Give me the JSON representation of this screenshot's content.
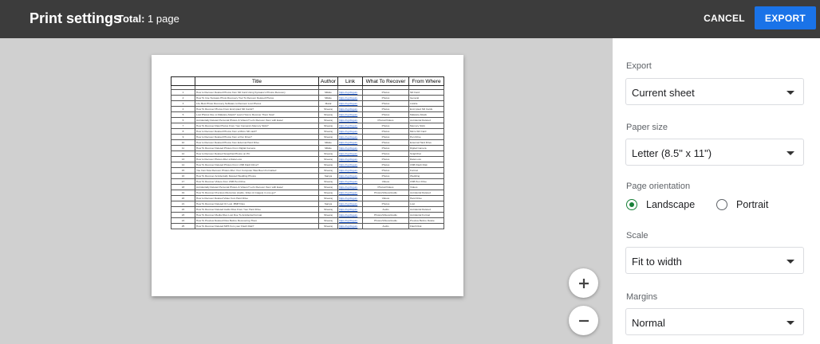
{
  "header": {
    "title": "Print settings",
    "total_label": "Total:",
    "total_value": "1 page",
    "cancel_label": "CANCEL",
    "export_label": "EXPORT",
    "export_color": "#1a73e8"
  },
  "sheet": {
    "columns": [
      "",
      "Title",
      "Author",
      "Link",
      "What To Recover",
      "From Where"
    ],
    "rows": [
      [
        "1",
        "How to Recover Deleted Photos from SD Card Using Sysware's Photos Recovery",
        "Mikkie",
        "https://sysfixguru",
        "Photos",
        "SD Card"
      ],
      [
        "2",
        "How To Use Sysware Photo Recovery Tool To Recover Deleted Photos",
        "Mikkie",
        "https://sysfixguru",
        "Photos",
        "General"
      ],
      [
        "3",
        "10+ Best Photo Recovery Software to Recover Lost Photos",
        "Maral",
        "https://sysfixguru",
        "Photos",
        "Listicle"
      ],
      [
        "4",
        "How To Recover Photos From Encrypted SD Cards?",
        "Sheeraj",
        "https://sysfixguru",
        "Photos",
        "Encrypted SD Cards"
      ],
      [
        "5",
        "Lost Photos Due to Malware Attack? Learn How to Recover Them Now!",
        "Sheeraj",
        "https://sysfixguru",
        "Photos",
        "Malware Attack"
      ],
      [
        "6",
        "Accidentally Deleted Personal Photos & Videos? Let's Recover them with Ease!",
        "Sheeraj",
        "https://sysfixguru",
        "Photos/Videos",
        "Accidental Deleted"
      ],
      [
        "7",
        "How To Recover Raw Photos From Your Camera's Memory Stick?",
        "Sheeraj",
        "https://sysfixguru",
        "Photos",
        "Memory Stick"
      ],
      [
        "8",
        "How to Recover Deleted Photos from a Micro SD card?",
        "Sheeraj",
        "https://sysfixguru",
        "Photos",
        "Micro SD Card"
      ],
      [
        "9",
        "How to Recover Deleted Photos from a Pen Drive?",
        "Sheeraj",
        "https://sysfixguru",
        "Photos",
        "Pen Drive"
      ],
      [
        "10",
        "How to Recover Deleted Photos from External Hard Drive",
        "Mikkie",
        "https://sysfixguru",
        "Photos",
        "External Hard Drive"
      ],
      [
        "11",
        "How To Recover Deleted Photos From Digital Camera",
        "Mikkie",
        "https://sysfixguru",
        "Photos",
        "Digital Camera"
      ],
      [
        "12",
        "How to Recover Deleted Snapchat Photos on PC",
        "Sheeraj",
        "https://sysfixguru",
        "Photos",
        "SnapChat"
      ],
      [
        "13",
        "How to Recover Photos After a Data Loss",
        "Sheeraj",
        "https://sysfixguru",
        "Photos",
        "Data Loss"
      ],
      [
        "14",
        "How To Recover Deleted Photos From USB Flash Drive?",
        "Sheeraj",
        "https://sysfixguru",
        "Photos",
        "USB Flash Disk"
      ],
      [
        "15",
        "You Can Now Recover Photos After Your Computer Was Been Formatted",
        "Sheeraj",
        "https://sysfixguru",
        "Photos",
        "Format"
      ],
      [
        "16",
        "How To Recover Accidentally Deleted Wedding Photos",
        "Saniya",
        "https://sysfixguru",
        "Photos",
        "Wedding"
      ],
      [
        "17",
        "How To Recover Videos from USB Pen Drive",
        "Sheeraj",
        "https://sysfixguru",
        "Videos",
        "USB Pen Drive"
      ],
      [
        "18",
        "Accidentally Deleted Personal Photos & Videos? Let's Recover them with Ease!",
        "Sheeraj",
        "https://sysfixguru",
        "Photos/Videos",
        "Videos"
      ],
      [
        "19",
        "How To Recover Precious Memories (Audio, Video & Images) in one go?",
        "Sheeraj",
        "https://sysfixguru",
        "Photos/Videos/Audio",
        "Accidental Deleted"
      ],
      [
        "20",
        "How to Recover Deleted Video from Hard Drive",
        "Sheeraj",
        "https://sysfixguru",
        "Videos",
        "Hard Drive"
      ],
      [
        "21",
        "How To Recover Deleted Or Lost .BMP Files",
        "Saniya",
        "https://sysfixguru",
        "Photos",
        "Lost"
      ],
      [
        "22",
        "How To Recover Deleted Audio Files From Your Hard Drive",
        "Sheeraj",
        "https://sysfixguru",
        "Audio",
        "Accidental Deleted"
      ],
      [
        "23",
        "How To Recover Media Files Lost Due To Accidental Format",
        "Sheeraj",
        "https://sysfixguru",
        "Photos/Videos/Audio",
        "Accidental Format"
      ],
      [
        "24",
        "How To Preview Deleted Files Before Recovering Them",
        "Sheeraj",
        "https://sysfixguru",
        "Photos/Videos/Audio",
        "Preview Before Delete"
      ],
      [
        "25",
        "How To Recover Deleted MP3 from your Flash Disk?",
        "Sheeraj",
        "https://sysfixguru",
        "Audio",
        "Flash Disk"
      ]
    ]
  },
  "zoom": {
    "in_icon": "plus-icon",
    "out_icon": "minus-icon"
  },
  "panel": {
    "export_label": "Export",
    "export_value": "Current sheet",
    "paper_label": "Paper size",
    "paper_value": "Letter (8.5\" x 11\")",
    "orientation_label": "Page orientation",
    "orientation_landscape": "Landscape",
    "orientation_portrait": "Portrait",
    "orientation_selected": "Landscape",
    "scale_label": "Scale",
    "scale_value": "Fit to width",
    "margins_label": "Margins",
    "margins_value": "Normal",
    "accent_color": "#188038"
  }
}
